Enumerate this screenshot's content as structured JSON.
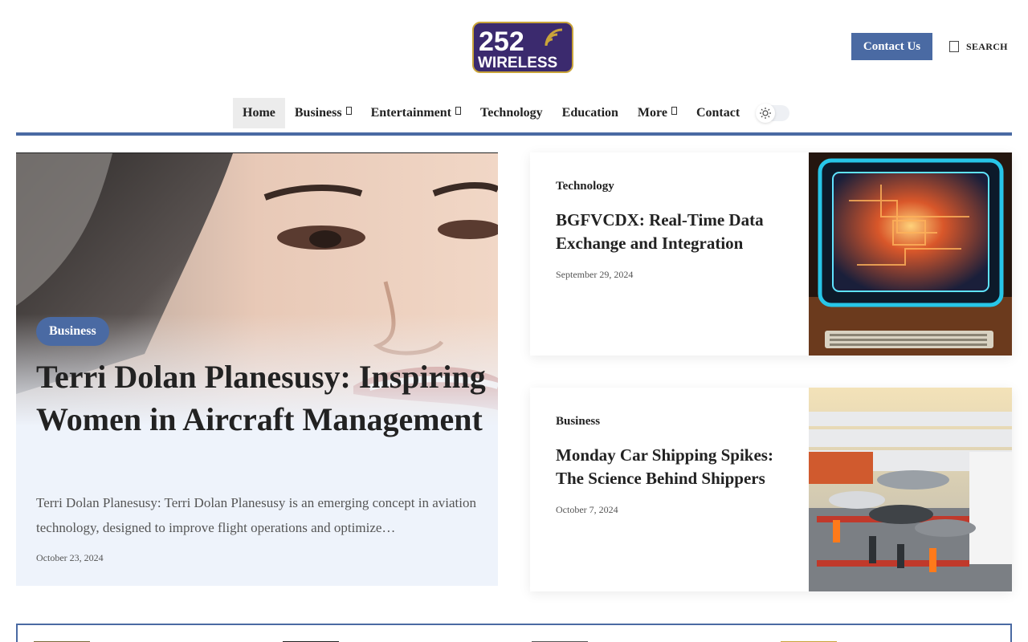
{
  "header": {
    "logo_text_top": "252",
    "logo_text_bottom": "WIRELESS",
    "contact_label": "Contact Us",
    "search_label": "SEARCH"
  },
  "nav": {
    "items": [
      {
        "label": "Home",
        "active": true,
        "dropdown": false
      },
      {
        "label": "Business",
        "active": false,
        "dropdown": true
      },
      {
        "label": "Entertainment",
        "active": false,
        "dropdown": true
      },
      {
        "label": "Technology",
        "active": false,
        "dropdown": false
      },
      {
        "label": "Education",
        "active": false,
        "dropdown": false
      },
      {
        "label": "More",
        "active": false,
        "dropdown": true
      },
      {
        "label": "Contact",
        "active": false,
        "dropdown": false
      }
    ]
  },
  "hero": {
    "category": "Business",
    "title": "Terri Dolan Planesusy: Inspiring Women in Aircraft Management",
    "excerpt": "Terri Dolan Planesusy: Terri Dolan Planesusy is an emerging concept in aviation technology, designed to improve flight operations and optimize…",
    "date": "October 23, 2024"
  },
  "cards": [
    {
      "category": "Technology",
      "title": "BGFVCDX: Real-Time Data Exchange and Integration",
      "date": "September 29, 2024"
    },
    {
      "category": "Business",
      "title": "Monday Car Shipping Spikes: The Science Behind Shippers",
      "date": "October 7, 2024"
    }
  ],
  "colors": {
    "accent": "#4a6aa3",
    "logo_purple": "#3b2a6e",
    "logo_gold": "#c9a43a"
  }
}
